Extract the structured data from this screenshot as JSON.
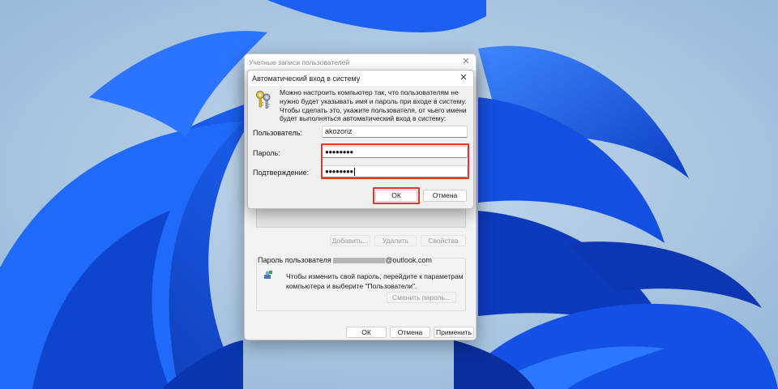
{
  "back_window": {
    "title": "Учетные записи пользователей",
    "buttons": {
      "add": "Добавить...",
      "remove": "Удалить",
      "properties": "Свойства"
    },
    "password_group": {
      "label_prefix": "Пароль пользователя",
      "label_suffix": "@outlook.com",
      "text": "Чтобы изменить свой пароль, перейдите к параметрам компьютера и выберите \"Пользователи\".",
      "change_button": "Сменить пароль..."
    },
    "footer": {
      "ok": "ОК",
      "cancel": "Отмена",
      "apply": "Применить"
    }
  },
  "dialog": {
    "title": "Автоматический вход в систему",
    "description": "Можно настроить компьютер так, что пользователям не нужно будет указывать имя и пароль при входе в систему. Чтобы сделать это, укажите пользователя, от чьего имени будет выполняться автоматический вход в систему:",
    "user_label": "Пользователь:",
    "user_value": "akozoriz",
    "password_label": "Пароль:",
    "password_value": "●●●●●●●●",
    "confirm_label": "Подтверждение:",
    "confirm_value": "●●●●●●●●",
    "ok": "ОК",
    "cancel": "Отмена"
  },
  "icons": {
    "close": "close-icon",
    "keys": "keys-icon",
    "user": "user-icon"
  },
  "colors": {
    "highlight": "#e0382a",
    "wallpaper_blue": "#1a5cf0",
    "background": "#9fc0de"
  }
}
